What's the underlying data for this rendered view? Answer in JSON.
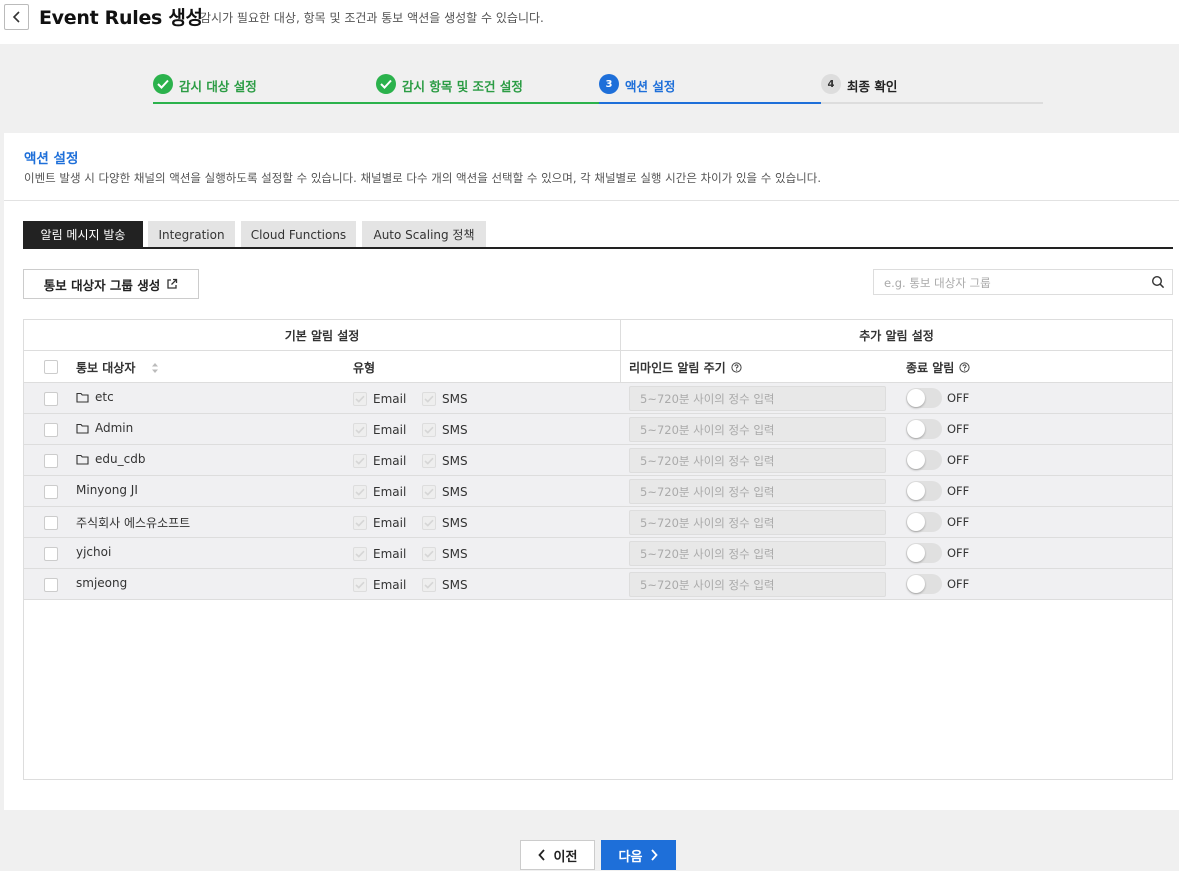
{
  "header": {
    "title": "Event Rules 생성",
    "subtitle": "감시가 필요한 대상, 항목 및 조건과 통보 액션을 생성할 수 있습니다."
  },
  "stepper": [
    {
      "num": "1",
      "label": "감시 대상 설정",
      "state": "done"
    },
    {
      "num": "2",
      "label": "감시 항목 및 조건 설정",
      "state": "done"
    },
    {
      "num": "3",
      "label": "액션 설정",
      "state": "active"
    },
    {
      "num": "4",
      "label": "최종 확인",
      "state": "todo"
    }
  ],
  "section": {
    "title": "액션 설정",
    "description": "이벤트 발생 시 다양한 채널의 액션을 실행하도록 설정할 수 있습니다. 채널별로 다수 개의 액션을 선택할 수 있으며, 각 채널별로 실행 시간은 차이가 있을 수 있습니다."
  },
  "tabs": [
    "알림 메시지 발송",
    "Integration",
    "Cloud Functions",
    "Auto Scaling 정책"
  ],
  "create_group_button": "통보 대상자 그룹 생성",
  "search": {
    "placeholder": "e.g. 통보 대상자 그룹"
  },
  "table": {
    "group_basic": "기본 알림 설정",
    "group_extra": "추가 알림 설정",
    "col_target": "통보 대상자",
    "col_type": "유형",
    "col_remind": "리마인드 알림 주기",
    "col_end": "종료 알림",
    "email_label": "Email",
    "sms_label": "SMS",
    "remind_placeholder": "5~720분 사이의 정수 입력",
    "toggle_label": "OFF",
    "rows": [
      {
        "name": "etc",
        "is_group": true
      },
      {
        "name": "Admin",
        "is_group": true
      },
      {
        "name": "edu_cdb",
        "is_group": true
      },
      {
        "name": "Minyong JI",
        "is_group": false
      },
      {
        "name": "주식회사 에스유소프트",
        "is_group": false
      },
      {
        "name": "yjchoi",
        "is_group": false
      },
      {
        "name": "smjeong",
        "is_group": false
      }
    ]
  },
  "footer": {
    "prev": "이전",
    "next": "다음"
  },
  "colors": {
    "done": "#2bb24c",
    "active": "#1e6fd9",
    "tab_active": "#222222"
  }
}
